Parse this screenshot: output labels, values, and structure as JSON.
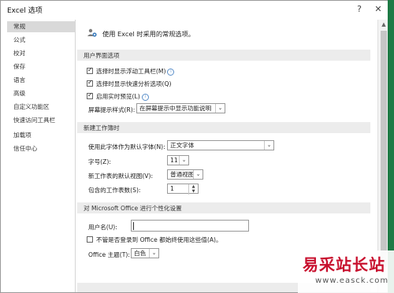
{
  "window": {
    "title": "Excel 选项",
    "help": "?",
    "close": "✕"
  },
  "sidebar": {
    "items": [
      {
        "label": "常规"
      },
      {
        "label": "公式"
      },
      {
        "label": "校对"
      },
      {
        "label": "保存"
      },
      {
        "label": "语言"
      },
      {
        "label": "高级"
      },
      {
        "label": "自定义功能区"
      },
      {
        "label": "快速访问工具栏"
      },
      {
        "label": "加载项"
      },
      {
        "label": "信任中心"
      }
    ],
    "selected_index": 0
  },
  "intro": {
    "text": "使用 Excel 时采用的常规选项。",
    "icon": "people-settings-icon"
  },
  "ui_options": {
    "header": "用户界面选项",
    "mini_toolbar": {
      "label": "选择时显示浮动工具栏(M)",
      "checked": true
    },
    "quick_analysis": {
      "label": "选择时显示快速分析选项(Q)",
      "checked": true
    },
    "live_preview": {
      "label": "启用实时预览(L)",
      "checked": true
    },
    "screentip": {
      "label": "屏幕提示样式(R):",
      "value": "在屏幕提示中显示功能说明"
    }
  },
  "new_workbook": {
    "header": "新建工作簿时",
    "font": {
      "label": "使用此字体作为默认字体(N):",
      "value": "正文字体"
    },
    "font_size": {
      "label": "字号(Z):",
      "value": "11"
    },
    "default_view": {
      "label": "新工作表的默认视图(V):",
      "value": "普通视图"
    },
    "sheet_count": {
      "label": "包含的工作表数(S):",
      "value": "1"
    }
  },
  "personalize": {
    "header": "对 Microsoft Office 进行个性化设置",
    "username": {
      "label": "用户名(U):",
      "value": ""
    },
    "always_use": {
      "label": "不管是否登录到 Office 都始终使用这些值(A)。",
      "checked": false
    },
    "theme": {
      "label": "Office 主题(T):",
      "value": "白色"
    }
  },
  "watermark": {
    "cn": "易采站长站",
    "url": "www.easck.com"
  },
  "colors": {
    "accent_green": "#1e7a45",
    "watermark_red": "#c8102e",
    "selected_bg": "#d9d9d9"
  }
}
